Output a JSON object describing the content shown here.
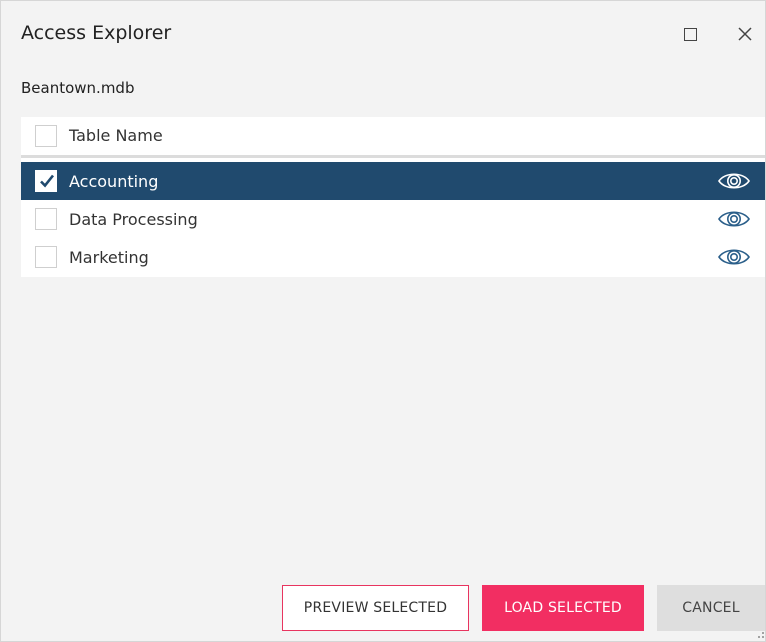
{
  "window": {
    "title": "Access Explorer",
    "maximize_icon": "maximize-icon",
    "close_icon": "close-icon"
  },
  "file": {
    "name": "Beantown.mdb"
  },
  "table": {
    "header_label": "Table Name",
    "header_checked": false,
    "rows": [
      {
        "label": "Accounting",
        "checked": true,
        "selected": true,
        "icon": "eye-icon"
      },
      {
        "label": "Data Processing",
        "checked": false,
        "selected": false,
        "icon": "eye-icon"
      },
      {
        "label": "Marketing",
        "checked": false,
        "selected": false,
        "icon": "eye-icon"
      }
    ]
  },
  "footer": {
    "preview_label": "PREVIEW SELECTED",
    "load_label": "LOAD SELECTED",
    "cancel_label": "CANCEL"
  },
  "colors": {
    "selected_row": "#204a6e",
    "load_button": "#f22e62",
    "preview_border": "#e8345f",
    "eye_icon": "#2b5f8a"
  }
}
